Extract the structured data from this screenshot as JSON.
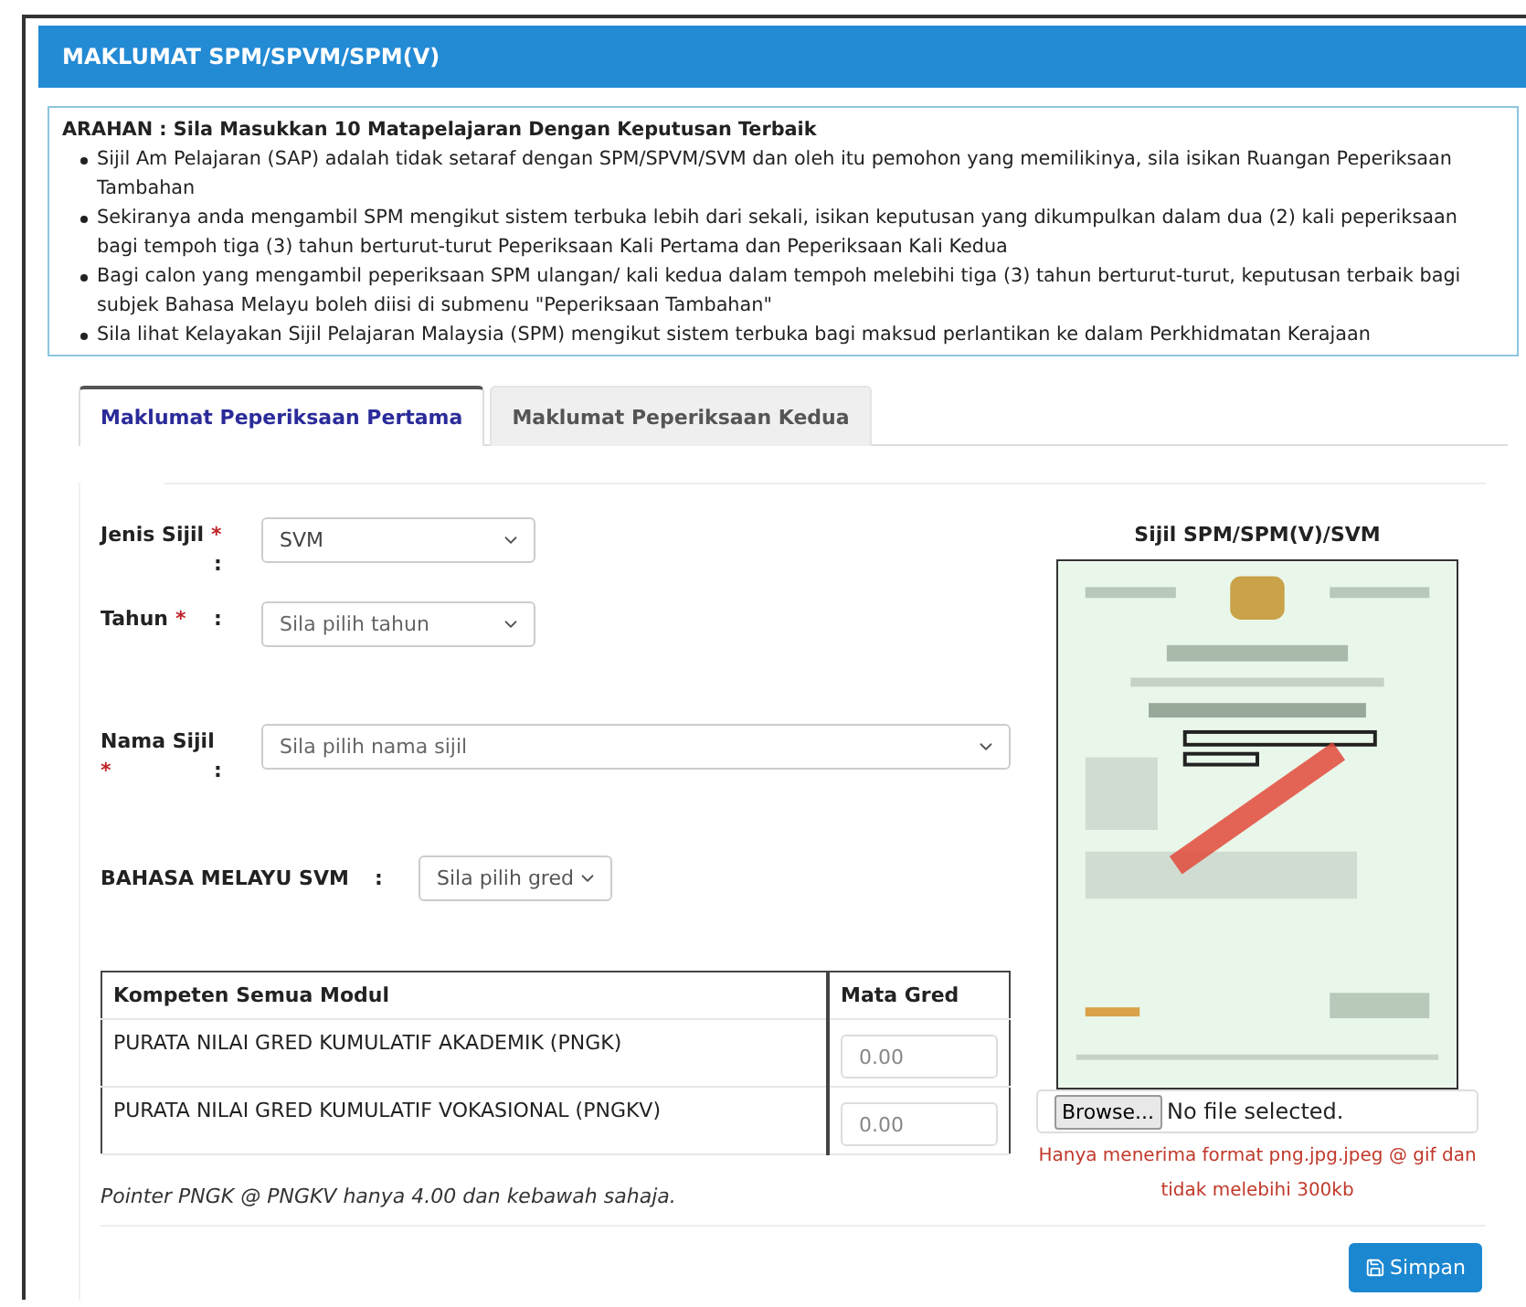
{
  "header": {
    "title": "MAKLUMAT SPM/SPVM/SPM(V)"
  },
  "instructions": {
    "heading": "ARAHAN : Sila Masukkan 10 Matapelajaran Dengan Keputusan Terbaik",
    "items": [
      "Sijil Am Pelajaran (SAP) adalah tidak setaraf dengan SPM/SPVM/SVM dan oleh itu pemohon yang memilikinya, sila isikan Ruangan Peperiksaan Tambahan",
      "Sekiranya anda mengambil SPM mengikut sistem terbuka lebih dari sekali, isikan keputusan yang dikumpulkan dalam dua (2) kali peperiksaan bagi tempoh tiga (3) tahun berturut-turut Peperiksaan Kali Pertama dan Peperiksaan Kali Kedua",
      "Bagi calon yang mengambil peperiksaan SPM ulangan/ kali kedua dalam tempoh melebihi tiga (3) tahun berturut-turut, keputusan terbaik bagi subjek Bahasa Melayu boleh diisi di submenu \"Peperiksaan Tambahan\"",
      "Sila lihat Kelayakan Sijil Pelajaran Malaysia (SPM) mengikut sistem terbuka bagi maksud perlantikan ke dalam Perkhidmatan Kerajaan"
    ]
  },
  "tabs": [
    {
      "label": "Maklumat Peperiksaan Pertama",
      "selected": true
    },
    {
      "label": "Maklumat Peperiksaan Kedua",
      "selected": false
    }
  ],
  "fields": [
    {
      "label": "Jenis Sijil",
      "required_mark": "*",
      "colon": ":",
      "value": "SVM",
      "wide": false,
      "mark_wraps": false
    },
    {
      "label": "Tahun",
      "required_mark": "*",
      "colon": ":",
      "placeholder": "Sila pilih tahun",
      "wide": false,
      "mark_wraps": false
    },
    {
      "label": "Nama Sijil",
      "required_mark": "*",
      "colon": ":",
      "placeholder": "Sila pilih nama sijil",
      "wide": true,
      "mark_wraps": true
    }
  ],
  "grade_field": {
    "label": "BAHASA MELAYU SVM",
    "colon": ":",
    "placeholder": "Sila pilih gred"
  },
  "table": {
    "columns": [
      "Kompeten Semua Modul",
      "Mata Gred"
    ],
    "rows": [
      {
        "label": "PURATA NILAI GRED KUMULATIF AKADEMIK (PNGK)",
        "placeholder": "0.00"
      },
      {
        "label": "PURATA NILAI GRED KUMULATIF VOKASIONAL (PNGKV)",
        "placeholder": "0.00"
      }
    ]
  },
  "note": "Pointer PNGK @ PNGKV hanya 4.00 dan kebawah sahaja.",
  "certificate": {
    "title": "Sijil SPM/SPM(V)/SVM",
    "browse_button": "Browse...",
    "file_status": "No file selected.",
    "hint": "Hanya menerima format png.jpg.jpeg @ gif dan tidak melebihi 300kb"
  },
  "save_button": {
    "label": "Simpan"
  }
}
